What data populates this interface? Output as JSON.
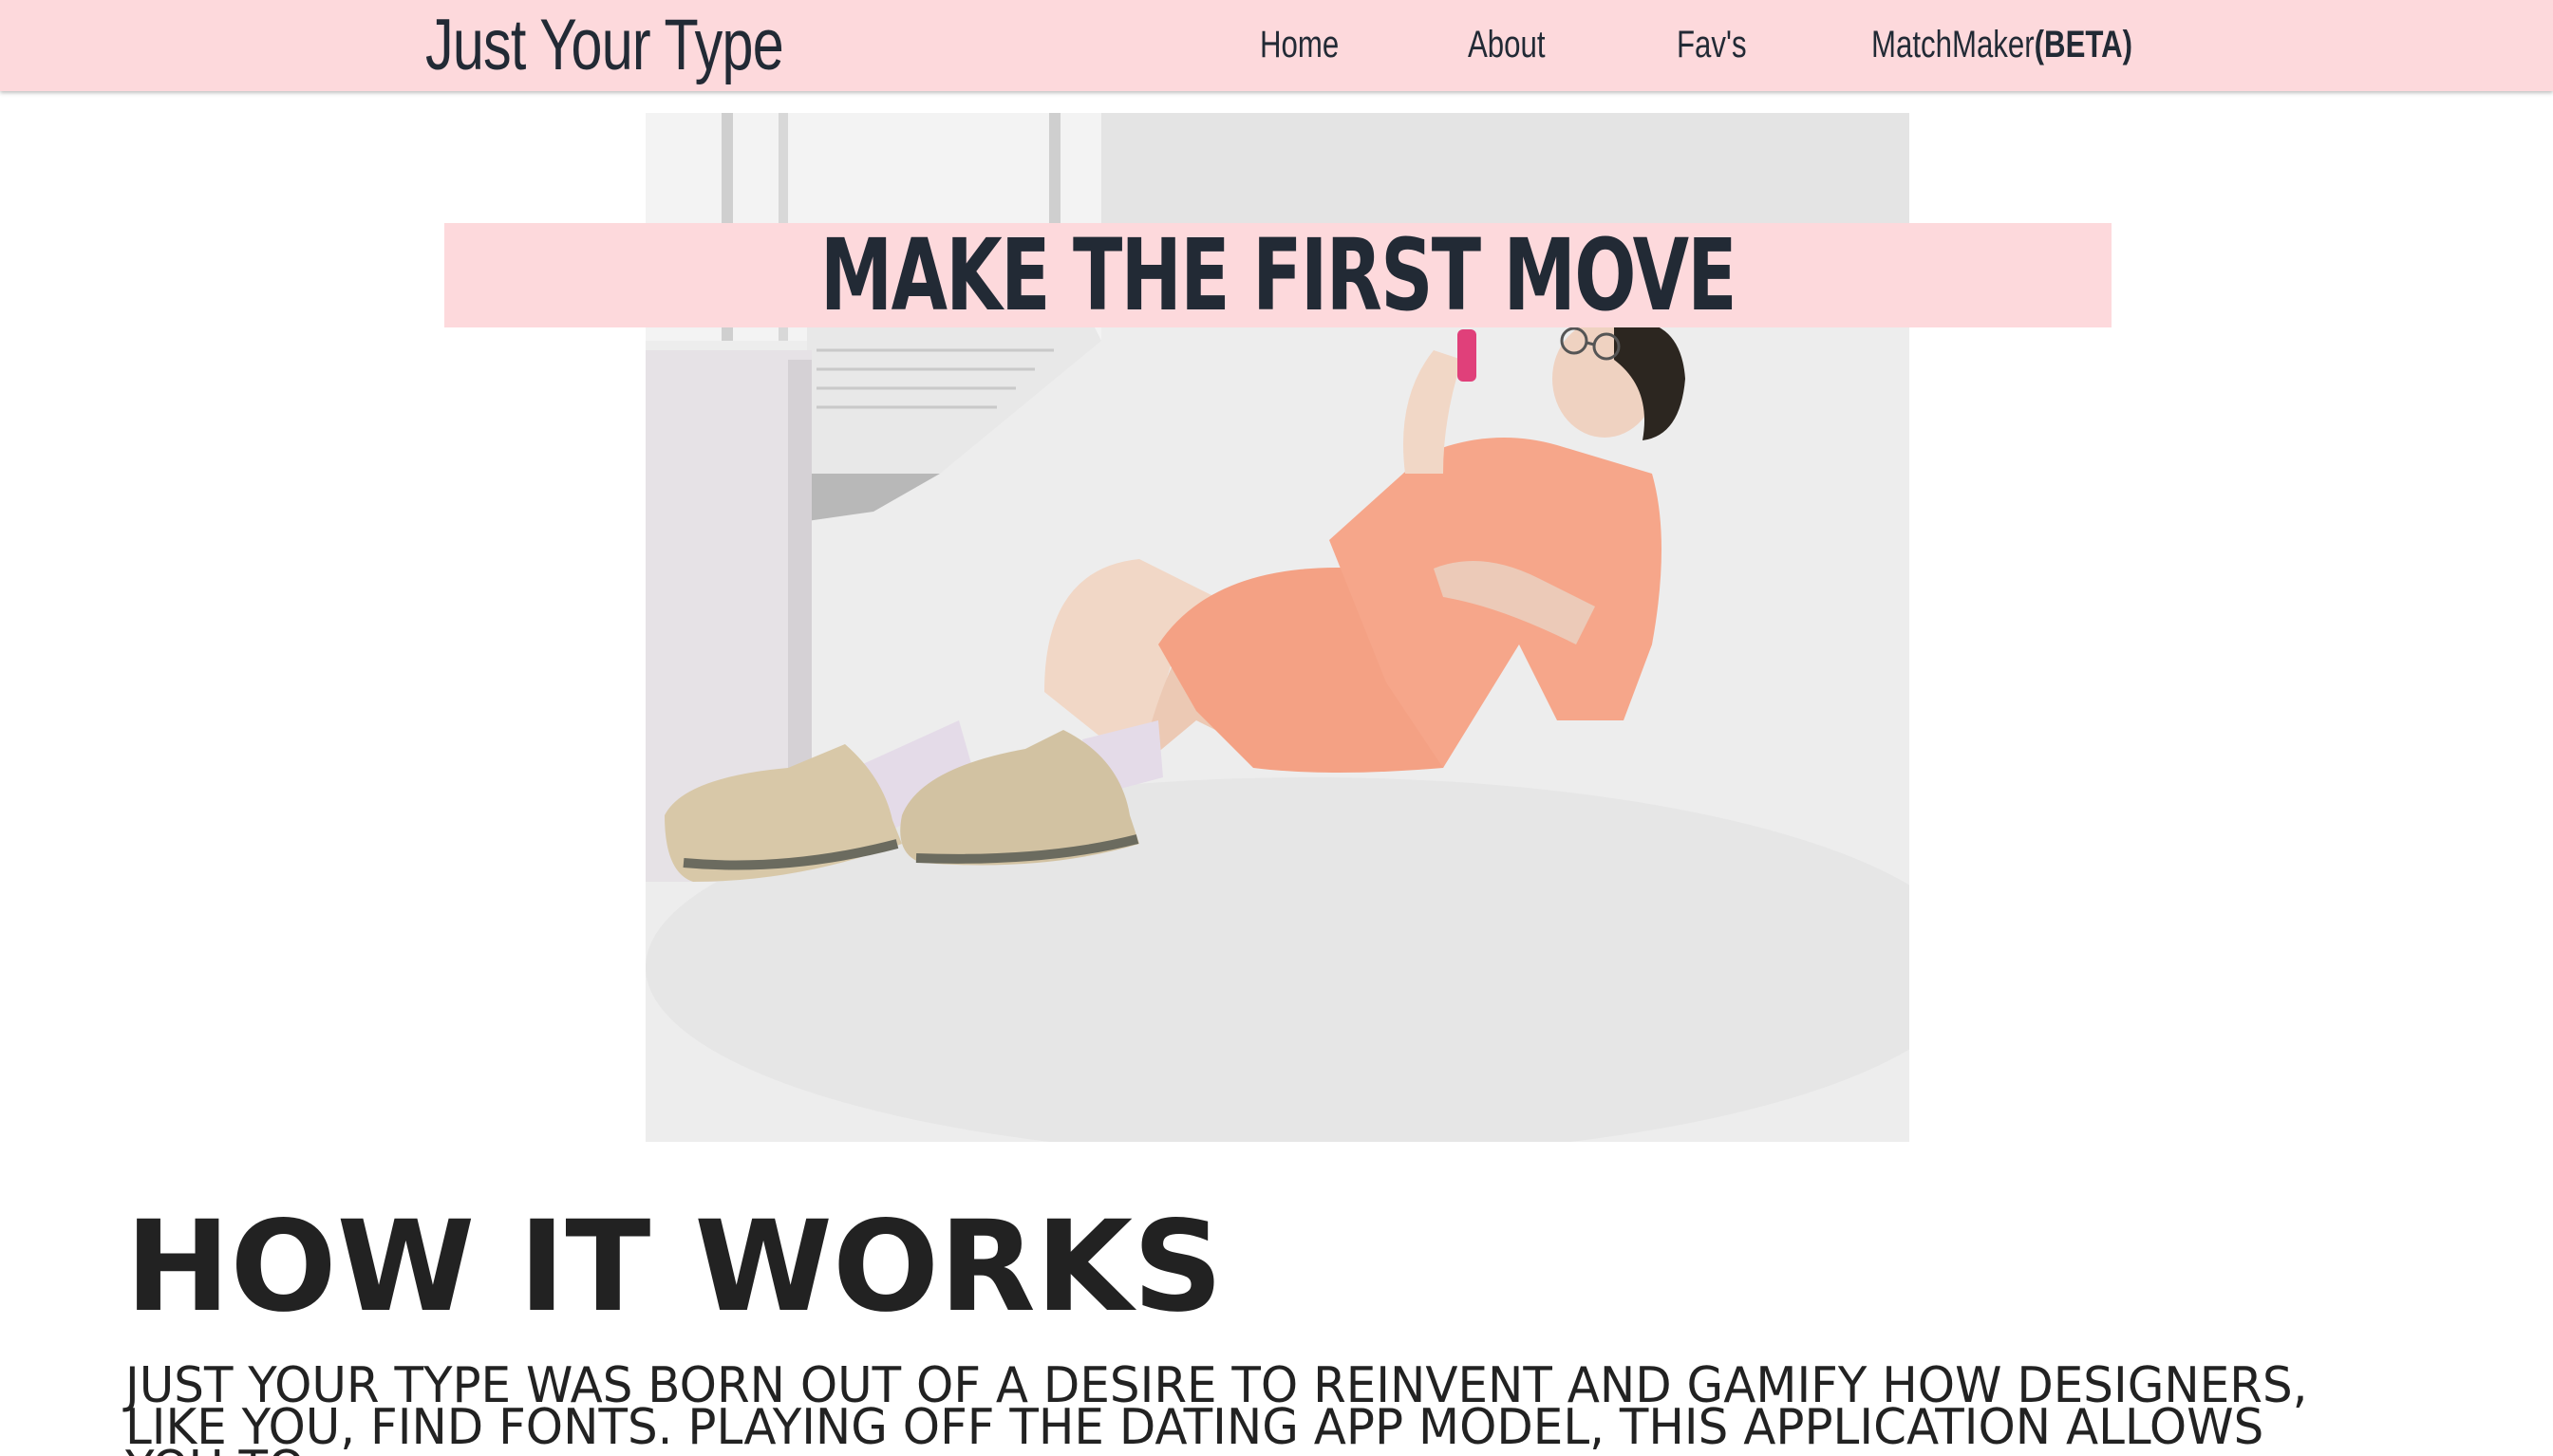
{
  "header": {
    "brand": "Just Your Type",
    "nav": {
      "home": "Home",
      "about": "About",
      "favs": "Fav's",
      "matchmaker": "MatchMaker",
      "matchmaker_badge": "(BETA)"
    }
  },
  "hero": {
    "title": "MAKE THE FIRST MOVE"
  },
  "how_it_works": {
    "title": "HOW IT WORKS",
    "body": "JUST YOUR TYPE WAS BORN OUT OF A DESIRE TO REINVENT AND GAMIFY HOW DESIGNERS, LIKE YOU, FIND FONTS. PLAYING OFF THE DATING APP MODEL, THIS APPLICATION ALLOWS YOU TO"
  },
  "colors": {
    "header_bg": "#fdd9dc",
    "banner_bg": "#fdd9dc",
    "text_dark": "#222a35",
    "outfit": "#f4a184"
  },
  "icons": {
    "hero_image": "person-lying-on-floor-with-phone-photo"
  }
}
